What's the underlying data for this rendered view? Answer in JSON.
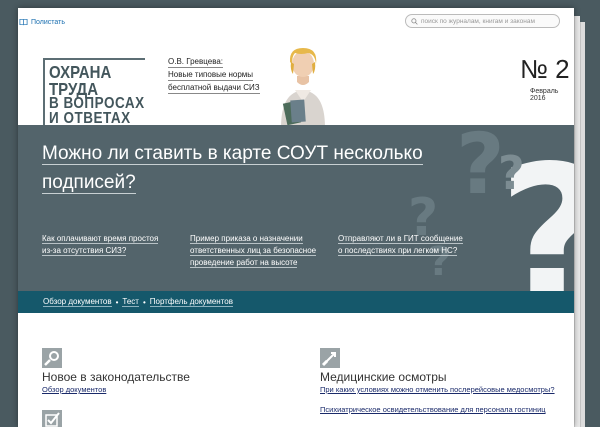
{
  "header": {
    "share_label": "Полистать",
    "search_placeholder": "поиск по журналам, книгам и законам"
  },
  "logo": {
    "lines": [
      "ОХРАНА ТРУДА",
      "В ВОПРОСАХ",
      "И ОТВЕТАХ"
    ]
  },
  "author": {
    "lines": [
      "О.В. Гревцева:",
      "Новые типовые нормы",
      "бесплатной выдачи СИЗ"
    ]
  },
  "issue": {
    "number": "№ 2",
    "date": "Февраль 2016"
  },
  "hero": {
    "title_line1": "Можно ли ставить в карте СОУТ несколько",
    "title_line2": "подписей?",
    "links": [
      [
        "Как оплачивают время простоя",
        "из-за отсутствия СИЗ?"
      ],
      [
        "Пример приказа о назначении",
        "ответственных лиц за безопасное",
        "проведение работ на высоте"
      ],
      [
        "Отправляют ли в ГИТ сообщение",
        "о последствиях при легком НС?"
      ]
    ]
  },
  "nav": {
    "items": [
      "Обзор документов",
      "Тест",
      "Портфель документов"
    ],
    "separator": "•"
  },
  "sections": {
    "left": {
      "title": "Новое в законодательстве",
      "link": "Обзор документов"
    },
    "right": {
      "title": "Медицинские осмотры",
      "links": [
        "При каких условиях можно отменить послерейсовые медосмотры?",
        "Психиатрическое освидетельствование для персонала гостиниц"
      ]
    }
  },
  "colors": {
    "hero_bg": "#53646b",
    "nav_bg": "#15586b",
    "link_blue": "#1a6fb0"
  }
}
